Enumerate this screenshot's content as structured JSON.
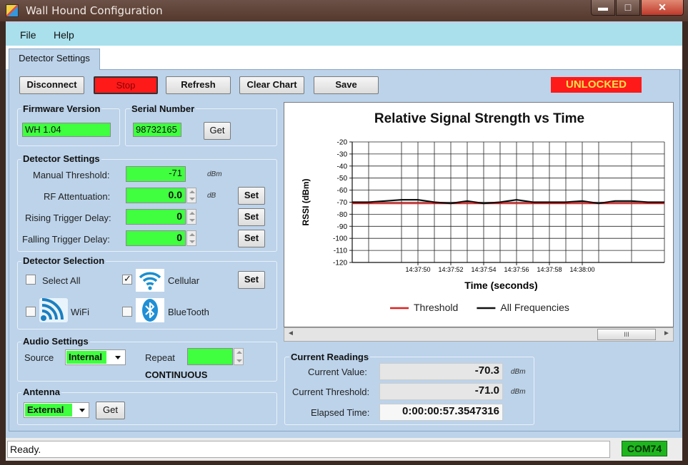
{
  "window": {
    "title": "Wall Hound Configuration",
    "min": "▬",
    "max": "□",
    "close": "✕"
  },
  "menu": [
    "File",
    "Help"
  ],
  "tab": "Detector Settings",
  "toolbar": {
    "disconnect": "Disconnect",
    "stop": "Stop",
    "refresh": "Refresh",
    "clear_chart": "Clear Chart",
    "save": "Save",
    "lock_status": "UNLOCKED"
  },
  "firmware": {
    "title": "Firmware Version",
    "value": "WH 1.04"
  },
  "serial": {
    "title": "Serial Number",
    "value": "98732165",
    "get": "Get"
  },
  "detector_settings": {
    "title": "Detector Settings",
    "manual_threshold": {
      "label": "Manual Threshold:",
      "value": "-71",
      "unit": "dBm"
    },
    "rf_attenuation": {
      "label": "RF Attentuation:",
      "value": "0.0",
      "unit": "dB",
      "set": "Set"
    },
    "rising_delay": {
      "label": "Rising Trigger Delay:",
      "value": "0",
      "set": "Set"
    },
    "falling_delay": {
      "label": "Falling Trigger Delay:",
      "value": "0",
      "set": "Set"
    }
  },
  "detector_selection": {
    "title": "Detector Selection",
    "select_all": "Select All",
    "cellular": "Cellular",
    "wifi": "WiFi",
    "bluetooth": "BlueTooth",
    "set": "Set"
  },
  "audio": {
    "title": "Audio Settings",
    "source_label": "Source",
    "source_value": "Internal",
    "repeat_label": "Repeat",
    "repeat_value": "",
    "repeat_mode": "CONTINUOUS"
  },
  "antenna": {
    "title": "Antenna",
    "value": "External",
    "get": "Get"
  },
  "chart_data": {
    "type": "line",
    "title": "Relative Signal Strength vs Time",
    "xlabel": "Time (seconds)",
    "ylabel": "RSSI (dBm)",
    "ylim": [
      -120,
      -20
    ],
    "yticks": [
      -20,
      -30,
      -40,
      -50,
      -60,
      -70,
      -80,
      -90,
      -100,
      -110,
      -120
    ],
    "xticks": [
      "14:37:50",
      "14:37:52",
      "14:37:54",
      "14:37:56",
      "14:37:58",
      "14:38:00"
    ],
    "grid": true,
    "legend_position": "bottom",
    "series": [
      {
        "name": "Threshold",
        "color": "#e02020",
        "points": [
          [
            "14:37:46",
            -71
          ],
          [
            "14:38:05",
            -71
          ]
        ]
      },
      {
        "name": "All Frequencies",
        "color": "#111111",
        "points": [
          [
            "14:37:46",
            -70
          ],
          [
            "14:37:47",
            -70
          ],
          [
            "14:37:48",
            -69
          ],
          [
            "14:37:49",
            -68
          ],
          [
            "14:37:50",
            -68
          ],
          [
            "14:37:51",
            -70
          ],
          [
            "14:37:52",
            -71
          ],
          [
            "14:37:53",
            -69
          ],
          [
            "14:37:54",
            -71
          ],
          [
            "14:37:55",
            -70
          ],
          [
            "14:37:56",
            -68
          ],
          [
            "14:37:57",
            -70
          ],
          [
            "14:37:58",
            -70
          ],
          [
            "14:37:59",
            -70
          ],
          [
            "14:38:00",
            -69
          ],
          [
            "14:38:01",
            -71
          ],
          [
            "14:38:02",
            -69
          ],
          [
            "14:38:03",
            -69
          ],
          [
            "14:38:04",
            -70
          ],
          [
            "14:38:05",
            -70
          ]
        ]
      }
    ]
  },
  "scroll_thumb": "III",
  "current_readings": {
    "title": "Current Readings",
    "current_value": {
      "label": "Current Value:",
      "value": "-70.3",
      "unit": "dBm"
    },
    "current_threshold": {
      "label": "Current Threshold:",
      "value": "-71.0",
      "unit": "dBm"
    },
    "elapsed": {
      "label": "Elapsed Time:",
      "value": "0:00:00:57.3547316"
    }
  },
  "status": {
    "text": "Ready.",
    "port": "COM74"
  }
}
